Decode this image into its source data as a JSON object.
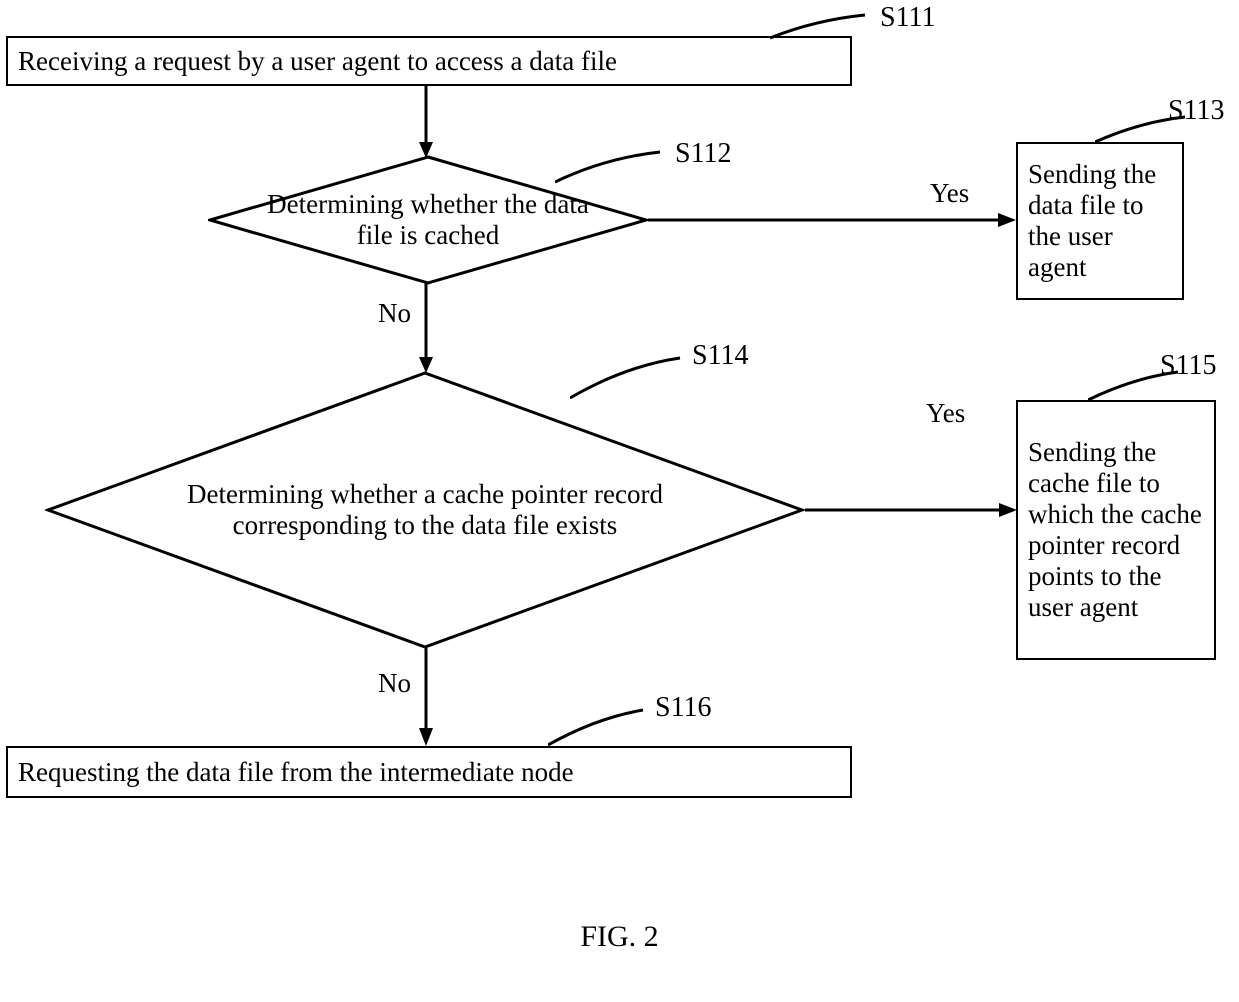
{
  "steps": {
    "s111": {
      "num": "S111",
      "text": "Receiving a request by a user agent to access a data file"
    },
    "s112": {
      "num": "S112",
      "text": "Determining whether the data file is cached"
    },
    "s113": {
      "num": "S113",
      "text": "Sending the data file to the user agent"
    },
    "s114": {
      "num": "S114",
      "text": "Determining whether a cache pointer record corresponding to the data file exists"
    },
    "s115": {
      "num": "S115",
      "text": "Sending the cache file to which the cache pointer record points to the user agent"
    },
    "s116": {
      "num": "S116",
      "text": "Requesting the data file from the intermediate node"
    }
  },
  "labels": {
    "yes": "Yes",
    "no": "No"
  },
  "figure": "FIG. 2"
}
